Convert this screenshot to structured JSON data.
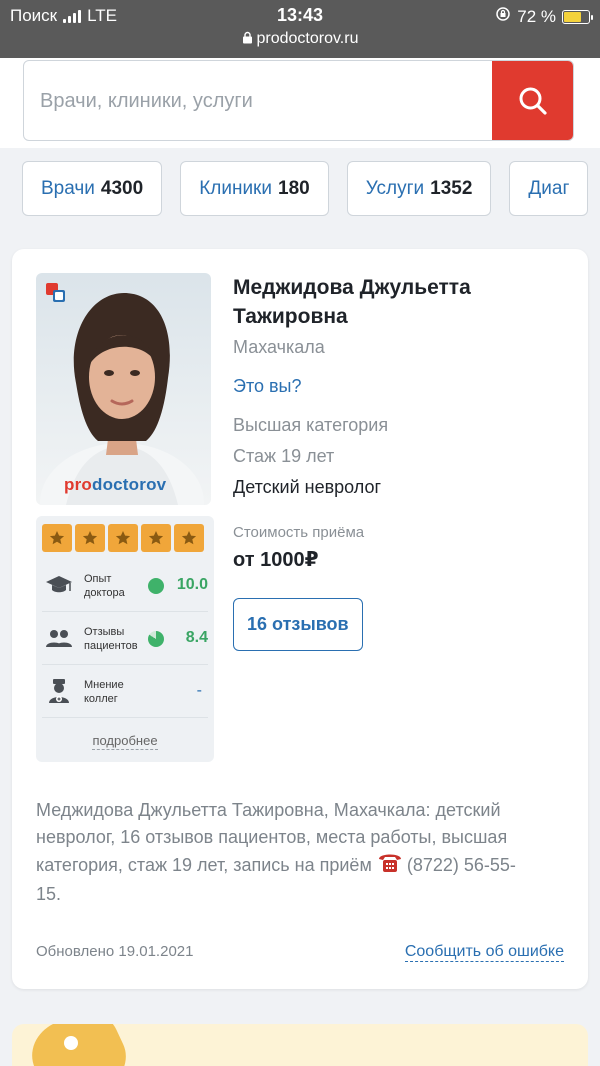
{
  "status_bar": {
    "carrier": "Поиск",
    "network": "LTE",
    "time": "13:43",
    "url": "prodoctorov.ru",
    "battery": "72 %"
  },
  "search": {
    "placeholder": "Врачи, клиники, услуги"
  },
  "tabs": [
    {
      "label": "Врачи",
      "count": "4300"
    },
    {
      "label": "Клиники",
      "count": "180"
    },
    {
      "label": "Услуги",
      "count": "1352"
    },
    {
      "label": "Диаг",
      "count": ""
    }
  ],
  "doctor": {
    "name": "Меджидова Джульетта Тажировна",
    "city": "Махачкала",
    "its_you": "Это вы?",
    "category": "Высшая категория",
    "experience": "Стаж 19 лет",
    "specialty": "Детский невролог",
    "price_label": "Стоимость приёма",
    "price": "от 1000₽",
    "reviews_button": "16 отзывов",
    "photo_brand_pro": "pro",
    "photo_brand_doctorov": "doctorov"
  },
  "ratings": {
    "stars": 5,
    "rows": [
      {
        "label_line1": "Опыт",
        "label_line2": "доктора",
        "value": "10.0",
        "icon": "graduation-cap-icon"
      },
      {
        "label_line1": "Отзывы",
        "label_line2": "пациентов",
        "value": "8.4",
        "icon": "patients-icon"
      },
      {
        "label_line1": "Мнение",
        "label_line2": "коллег",
        "value": "-",
        "icon": "doctor-icon"
      }
    ],
    "more": "подробнее"
  },
  "description": {
    "text": "Меджидова Джульетта Тажировна, Махачкала: детский невролог, 16 отзывов пациентов, места работы, высшая категория, стаж 19 лет, запись на приём",
    "phone": "(8722) 56-55-15."
  },
  "footer": {
    "updated": "Обновлено 19.01.2021",
    "report": "Сообщить об ошибке"
  },
  "colors": {
    "accent_blue": "#2a6fb1",
    "search_red": "#e03a2f",
    "star_orange": "#f0a63a",
    "rating_green": "#3aa564"
  }
}
